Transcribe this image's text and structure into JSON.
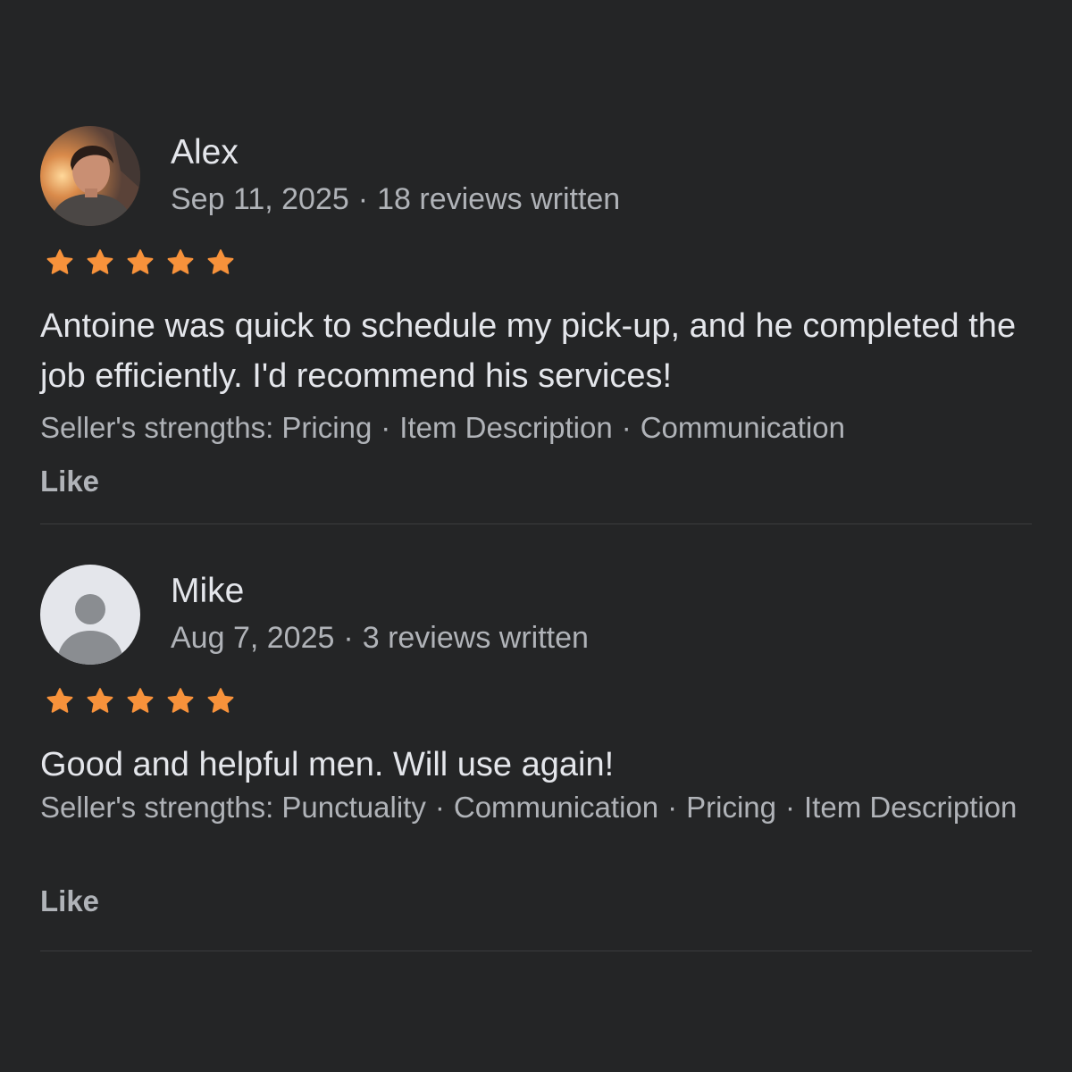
{
  "colors": {
    "background": "#242526",
    "primary_text": "#e4e6eb",
    "secondary_text": "#b0b3b8",
    "star": "#f7923b",
    "divider": "#3b3c3e"
  },
  "reviews": [
    {
      "name": "Alex",
      "date": "Sep 11, 2025",
      "reviews_written": "18 reviews written",
      "rating": 5,
      "avatar": "profile-photo",
      "text": "Antoine was quick to schedule my pick-up, and he completed the job efficiently. I'd recommend his services!",
      "strengths_label": "Seller's strengths:",
      "strengths": [
        "Pricing",
        "Item Description",
        "Communication"
      ],
      "like_label": "Like"
    },
    {
      "name": "Mike",
      "date": "Aug 7, 2025",
      "reviews_written": "3 reviews written",
      "rating": 5,
      "avatar": "default-avatar-icon",
      "text": "Good and helpful men. Will use again!",
      "strengths_label": "Seller's strengths:",
      "strengths": [
        "Punctuality",
        "Communication",
        "Pricing",
        "Item Description"
      ],
      "like_label": "Like"
    }
  ]
}
